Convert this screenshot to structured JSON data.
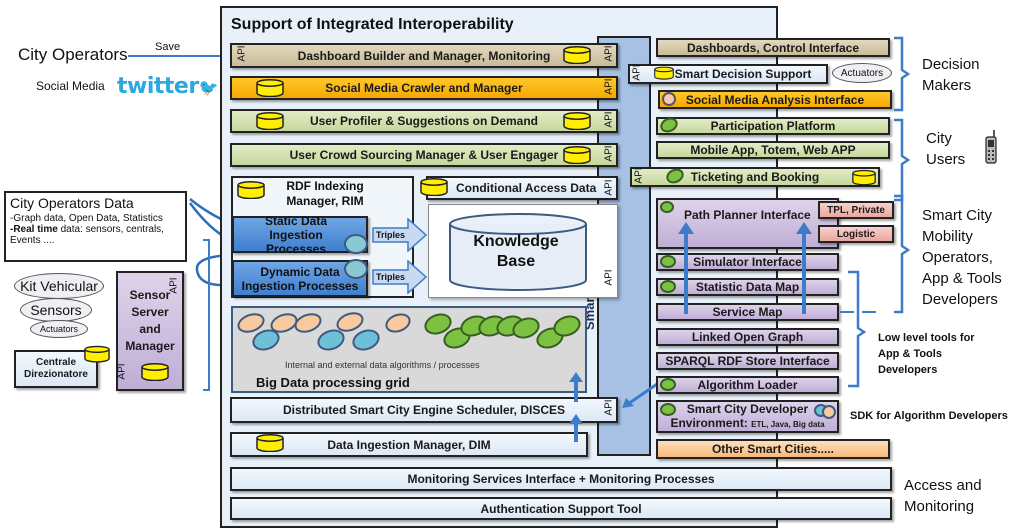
{
  "left": {
    "city_operators": "City Operators",
    "save": "Save",
    "social_media": "Social Media",
    "twitter": "twitter",
    "operators_data": {
      "title": "City Operators Data",
      "line1": "-Graph data, Open Data, Statistics",
      "line2_bold": "-Real time",
      "line2_rest": " data: sensors, centrals,",
      "line3": "Events ...."
    },
    "clouds": [
      "Kit Vehicular",
      "Sensors",
      "Actuators"
    ],
    "centrale": "Centrale Direzionatore",
    "sensor_server": "Sensor Server and Manager"
  },
  "main": {
    "title": "Support of  Integrated Interoperability",
    "api": "API",
    "dashboard_builder": "Dashboard Builder  and Manager, Monitoring",
    "social_crawler": "Social Media Crawler and Manager",
    "user_profiler": "User Profiler  &  Suggestions on Demand",
    "crowd_sourcing": "User Crowd Sourcing Manager & User Engager",
    "rdf_indexing": "RDF Indexing Manager, RIM",
    "conditional_access": "Conditional Access Data",
    "static_ingestion": "Static Data Ingestion Processes",
    "dynamic_ingestion": "Dynamic Data Ingestion Processes",
    "triples": "Triples",
    "knowledge_base": "Knowledge Base",
    "algorithms_caption": "Internal and external data algorithms / processes",
    "big_data_grid": "Big Data processing grid",
    "disces": "Distributed  Smart City Engine Scheduler, DISCES",
    "dim": "Data Ingestion Manager, DIM",
    "smart_city_api": "Smart City API",
    "monitoring": "Monitoring Services Interface  +  Monitoring Processes",
    "authentication": "Authentication Support Tool"
  },
  "right": {
    "dashboards": "Dashboards, Control Interface",
    "smart_decision": "Smart Decision Support",
    "actuators": "Actuators",
    "social_analysis": "Social Media Analysis Interface",
    "participation": "Participation Platform",
    "mobile_app": "Mobile App, Totem, Web APP",
    "ticketing": "Ticketing and Booking",
    "path_planner": "Path Planner Interface",
    "tpl_private": "TPL, Private",
    "logistic": "Logistic",
    "simulator": "Simulator Interface",
    "statistic_map": "Statistic Data Map",
    "service_map": "Service Map",
    "linked_open_graph": "Linked Open Graph",
    "sparql": "SPARQL RDF Store Interface",
    "algorithm_loader": "Algorithm Loader",
    "dev_env_line1": "Smart City Developer",
    "dev_env_line2": "Environment:",
    "dev_env_line2_small": "ETL, Java, Big data",
    "other_cities": "Other Smart Cities....."
  },
  "groups": {
    "decision_makers": "Decision Makers",
    "city_users": "City Users",
    "mobility_operators": "Smart City Mobility Operators, App & Tools Developers",
    "low_level_tools": "Low level tools for App & Tools Developers",
    "sdk": "SDK for Algorithm  Developers",
    "access_monitoring": "Access and Monitoring"
  },
  "colors": {
    "accent_blue": "#3d7cc9",
    "twitter_blue": "#2aa9e0",
    "orange": "#f5a800",
    "api_column": "#a6c1e3"
  }
}
